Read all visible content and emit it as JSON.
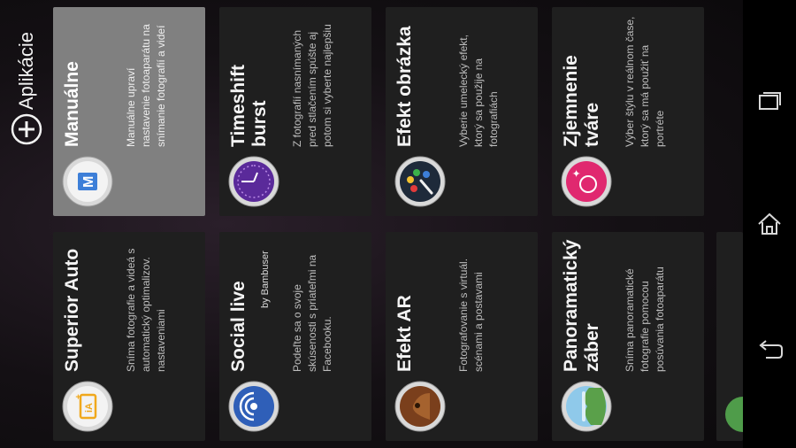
{
  "header": {
    "title": "Aplikácie"
  },
  "tiles": [
    {
      "title": "Superior Auto",
      "subtitle": "",
      "description": "Sníma fotografie a videá s automatický optimalizov. nastaveniami",
      "icon": "superior-auto-icon",
      "selected": false
    },
    {
      "title": "Manuálne",
      "subtitle": "",
      "description": "Manuálne upraví nastavenie fotoaparátu na snímanie fotografií a videí",
      "icon": "manual-icon",
      "selected": true
    },
    {
      "title": "Social live",
      "subtitle": "by Bambuser",
      "description": "Podeľte sa o svoje skúsenosti s priateľmi na Facebooku.",
      "icon": "social-live-icon",
      "selected": false
    },
    {
      "title": "Timeshift burst",
      "subtitle": "",
      "description": "Z fotografií nasnímaných pred stlačením spúšte aj potom si vyberte najlepšiu",
      "icon": "timeshift-burst-icon",
      "selected": false
    },
    {
      "title": "Efekt AR",
      "subtitle": "",
      "description": "Fotografovanie s virtuál. scénami a postavami",
      "icon": "ar-effect-icon",
      "selected": false
    },
    {
      "title": "Efekt obrázka",
      "subtitle": "",
      "description": "Vyberie umelecký efekt, ktorý sa použije na fotografiách",
      "icon": "picture-effect-icon",
      "selected": false
    },
    {
      "title": "Panoramatický záber",
      "subtitle": "",
      "description": "Sníma panoramatické fotografie pomocou posúvania fotoaparátu",
      "icon": "panorama-icon",
      "selected": false
    },
    {
      "title": "Zjemnenie tváre",
      "subtitle": "",
      "description": "Výber štýlu v reálnom čase, ktorý sa má použiť na portréte",
      "icon": "face-soften-icon",
      "selected": false
    }
  ],
  "navigation": {
    "recent": "recent-apps-icon",
    "home": "home-icon",
    "back": "back-icon"
  }
}
